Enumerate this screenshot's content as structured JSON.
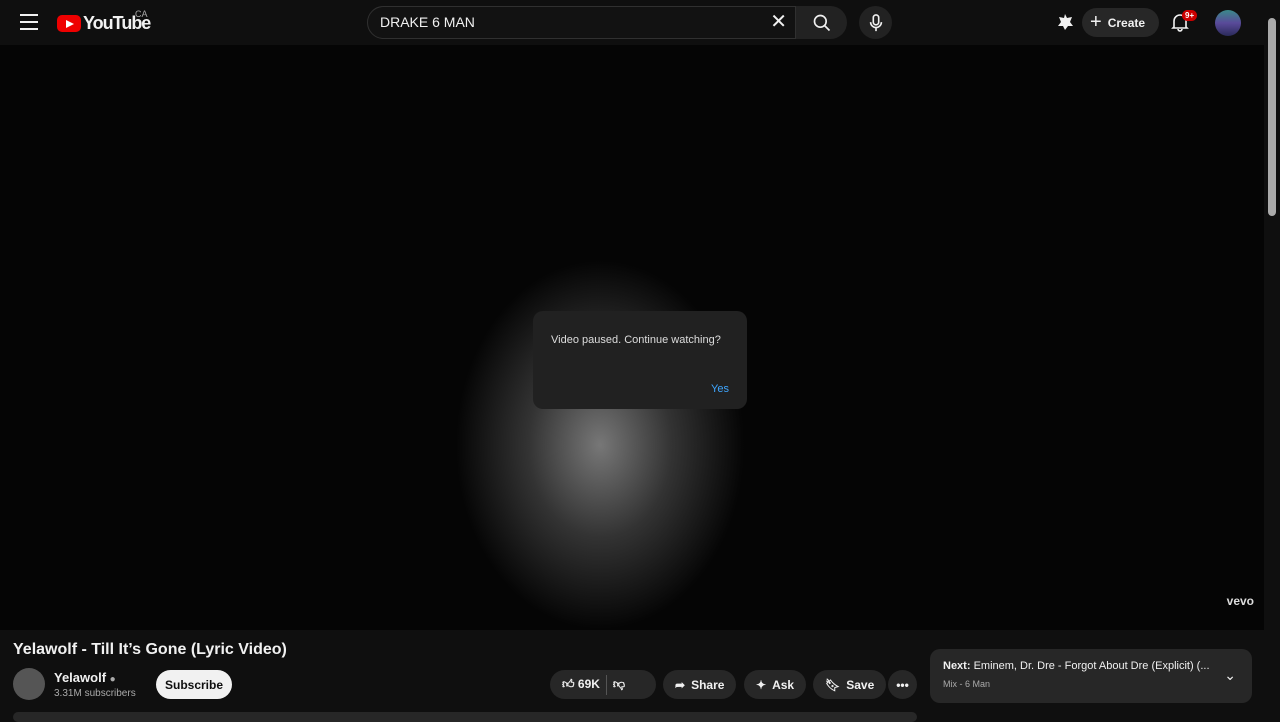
{
  "header": {
    "logo": "YouTube",
    "country": "CA",
    "search_value": "DRAKE 6 MAN",
    "create_label": "Create",
    "notif_badge": "9+"
  },
  "player": {
    "watermark": "vevo",
    "dialog": {
      "message": "Video paused. Continue watching?",
      "yes": "Yes"
    }
  },
  "video": {
    "title": "Yelawolf - Till It’s Gone (Lyric Video)",
    "channel": "Yelawolf",
    "subscribers": "3.31M subscribers",
    "subscribe": "Subscribe",
    "likes": "69K",
    "share": "Share",
    "ask": "Ask",
    "save": "Save"
  },
  "next": {
    "prefix": "Next:",
    "title": " Eminem, Dr. Dre - Forgot About Dre (Explicit) (...",
    "sub": "Mix - 6 Man"
  }
}
